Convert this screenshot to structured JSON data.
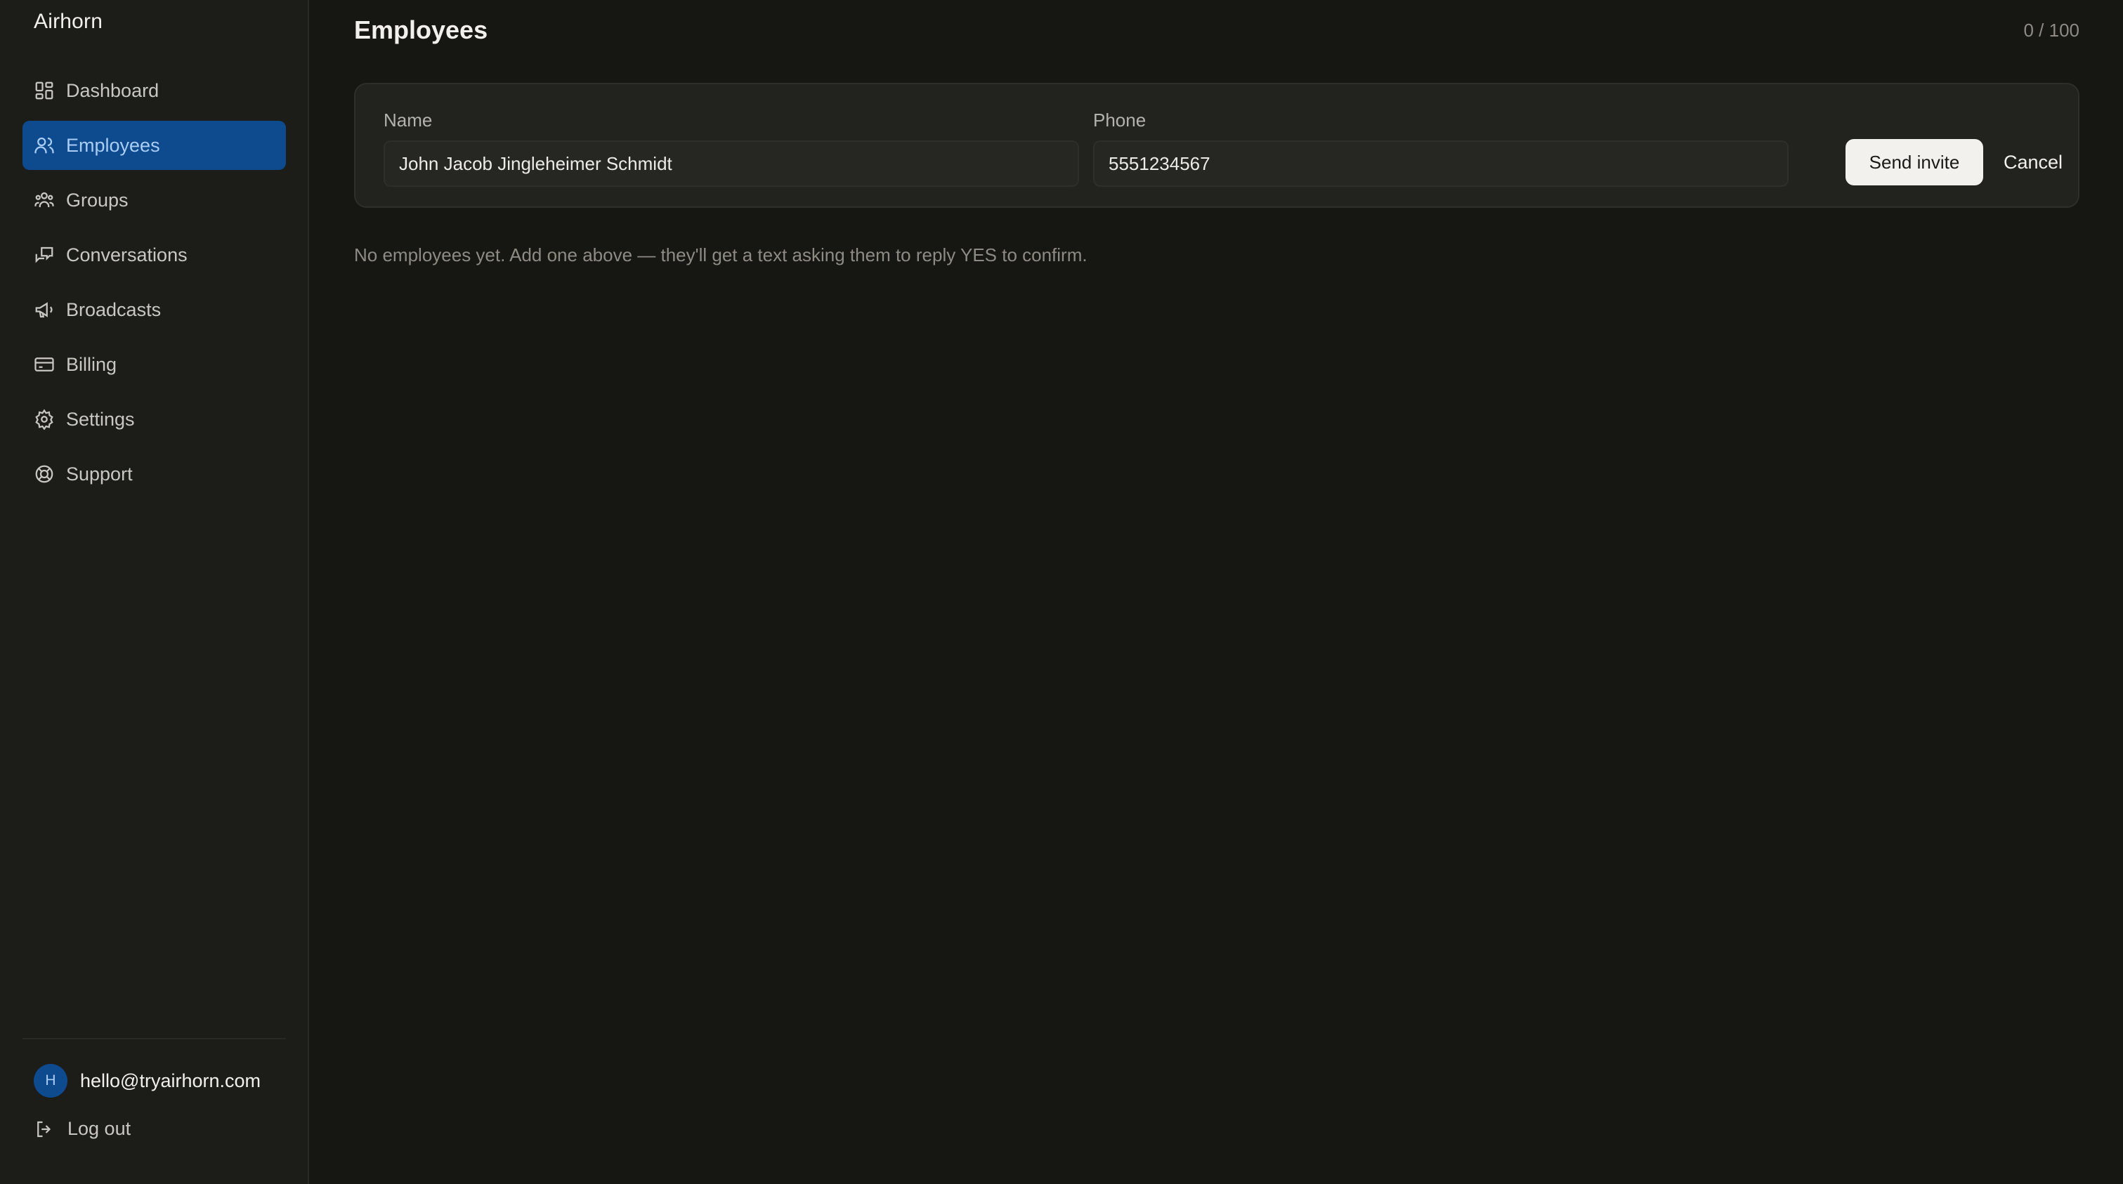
{
  "app": {
    "brand": "Airhorn"
  },
  "sidebar": {
    "items": [
      {
        "label": "Dashboard",
        "icon": "dashboard-icon",
        "active": false
      },
      {
        "label": "Employees",
        "icon": "users-icon",
        "active": true
      },
      {
        "label": "Groups",
        "icon": "groups-icon",
        "active": false
      },
      {
        "label": "Conversations",
        "icon": "conversations-icon",
        "active": false
      },
      {
        "label": "Broadcasts",
        "icon": "megaphone-icon",
        "active": false
      },
      {
        "label": "Billing",
        "icon": "credit-card-icon",
        "active": false
      },
      {
        "label": "Settings",
        "icon": "gear-icon",
        "active": false
      },
      {
        "label": "Support",
        "icon": "lifebuoy-icon",
        "active": false
      }
    ],
    "account": {
      "avatar_initial": "H",
      "email": "hello@tryairhorn.com"
    },
    "logout_label": "Log out"
  },
  "main": {
    "title": "Employees",
    "counter": "0 / 100",
    "form": {
      "name_label": "Name",
      "name_value": "John Jacob Jingleheimer Schmidt",
      "phone_label": "Phone",
      "phone_value": "5551234567",
      "send_label": "Send invite",
      "cancel_label": "Cancel"
    },
    "empty_message": "No employees yet. Add one above — they'll get a text asking them to reply YES to confirm."
  },
  "colors": {
    "background": "#161612",
    "sidebar": "#1c1c18",
    "accent": "#0e4a8e",
    "accent_text": "#a9cdf6"
  }
}
